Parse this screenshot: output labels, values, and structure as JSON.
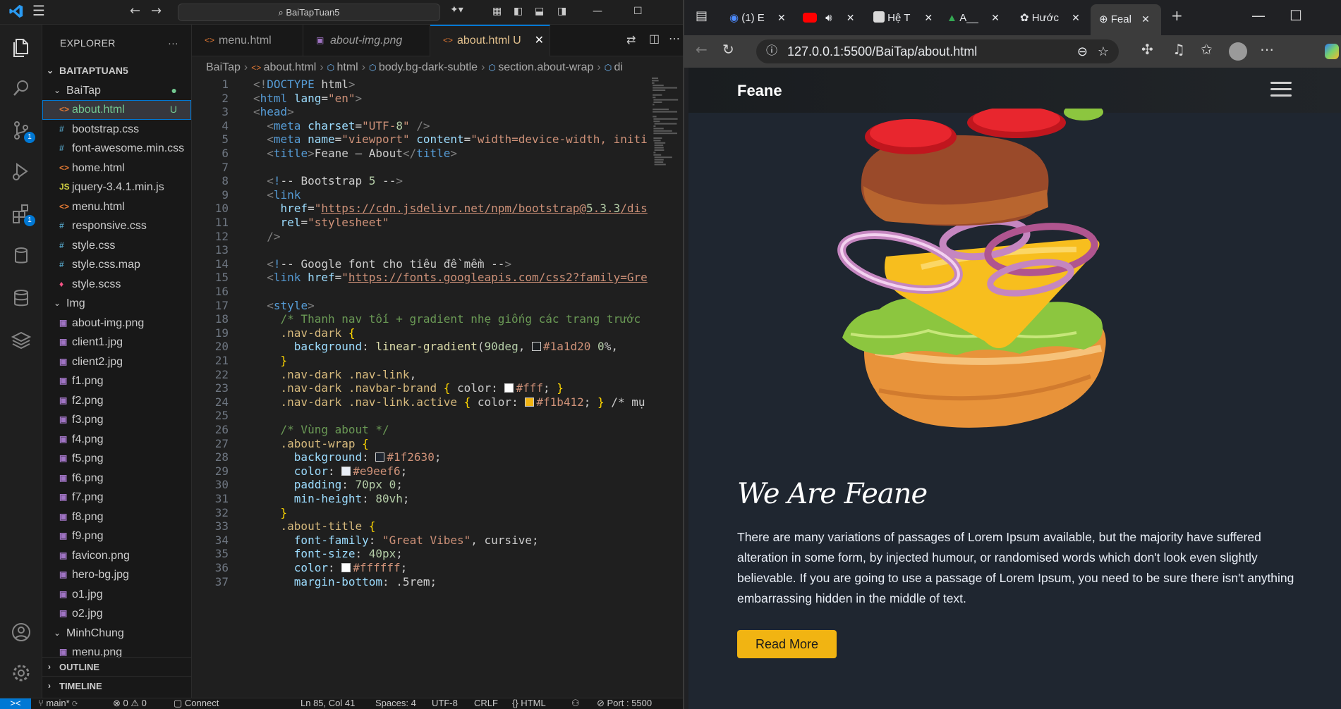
{
  "vscode": {
    "search_text": "BaiTapTuan5",
    "explorer_title": "EXPLORER",
    "project_name": "BAITAPTUAN5",
    "tree": [
      {
        "name": "BaiTap",
        "type": "folder",
        "status": "●"
      },
      {
        "name": "about.html",
        "type": "html",
        "status": "U",
        "selected": true
      },
      {
        "name": "bootstrap.css",
        "type": "css"
      },
      {
        "name": "font-awesome.min.css",
        "type": "css"
      },
      {
        "name": "home.html",
        "type": "html"
      },
      {
        "name": "jquery-3.4.1.min.js",
        "type": "js"
      },
      {
        "name": "menu.html",
        "type": "html"
      },
      {
        "name": "responsive.css",
        "type": "css"
      },
      {
        "name": "style.css",
        "type": "css"
      },
      {
        "name": "style.css.map",
        "type": "css"
      },
      {
        "name": "style.scss",
        "type": "scss"
      },
      {
        "name": "Img",
        "type": "folder"
      },
      {
        "name": "about-img.png",
        "type": "img"
      },
      {
        "name": "client1.jpg",
        "type": "img"
      },
      {
        "name": "client2.jpg",
        "type": "img"
      },
      {
        "name": "f1.png",
        "type": "img"
      },
      {
        "name": "f2.png",
        "type": "img"
      },
      {
        "name": "f3.png",
        "type": "img"
      },
      {
        "name": "f4.png",
        "type": "img"
      },
      {
        "name": "f5.png",
        "type": "img"
      },
      {
        "name": "f6.png",
        "type": "img"
      },
      {
        "name": "f7.png",
        "type": "img"
      },
      {
        "name": "f8.png",
        "type": "img"
      },
      {
        "name": "f9.png",
        "type": "img"
      },
      {
        "name": "favicon.png",
        "type": "img"
      },
      {
        "name": "hero-bg.jpg",
        "type": "img"
      },
      {
        "name": "o1.jpg",
        "type": "img"
      },
      {
        "name": "o2.jpg",
        "type": "img"
      },
      {
        "name": "MinhChung",
        "type": "folder"
      },
      {
        "name": "menu.png",
        "type": "img"
      }
    ],
    "outline_label": "OUTLINE",
    "timeline_label": "TIMELINE",
    "tabs": [
      {
        "label": "menu.html"
      },
      {
        "label": "about-img.png"
      },
      {
        "label": "about.html",
        "status": "U",
        "active": true
      }
    ],
    "breadcrumb": [
      "BaiTap",
      "about.html",
      "html",
      "body.bg-dark-subtle",
      "section.about-wrap",
      "di"
    ],
    "badges": {
      "source_control": "1",
      "extensions": "1"
    },
    "code_lines": [
      "<!DOCTYPE html>",
      "<html lang=\"en\">",
      "<head>",
      "  <meta charset=\"UTF-8\" />",
      "  <meta name=\"viewport\" content=\"width=device-width, initi",
      "  <title>Feane – About</title>",
      "",
      "  <!-- Bootstrap 5 -->",
      "  <link",
      "    href=\"https://cdn.jsdelivr.net/npm/bootstrap@5.3.3/dis",
      "    rel=\"stylesheet\"",
      "  />",
      "",
      "  <!-- Google font cho tiêu đề mềm -->",
      "  <link href=\"https://fonts.googleapis.com/css2?family=Gre",
      "",
      "  <style>",
      "    /* Thanh nav tối + gradient nhẹ giống các trang trước",
      "    .nav-dark {",
      "      background: linear-gradient(90deg, #1a1d20 0%, ",
      "    }",
      "    .nav-dark .nav-link,",
      "    .nav-dark .navbar-brand { color: #fff; }",
      "    .nav-dark .nav-link.active { color: #f1b412; } /* mụ",
      "",
      "    /* Vùng about */",
      "    .about-wrap {",
      "      background: #1f2630;",
      "      color: #e9eef6;",
      "      padding: 70px 0;",
      "      min-height: 80vh;",
      "    }",
      "    .about-title {",
      "      font-family: \"Great Vibes\", cursive;",
      "      font-size: 40px;",
      "      color: #ffffff;",
      "      margin-bottom: .5rem;"
    ],
    "status": {
      "branch": "main*",
      "problems": "⊗ 0 ⚠ 0",
      "connect": "Connect",
      "cursor": "Ln 85, Col 41",
      "spaces": "Spaces: 4",
      "encoding": "UTF-8",
      "eol": "CRLF",
      "language": "{} HTML",
      "port": "Port : 5500"
    }
  },
  "browser": {
    "tabs": [
      {
        "label": "(1) E"
      },
      {
        "label": ""
      },
      {
        "label": "Hệ T"
      },
      {
        "label": "A__"
      },
      {
        "label": "Hước"
      },
      {
        "label": "Feal",
        "active": true
      }
    ],
    "url": "127.0.0.1:5500/BaiTap/about.html",
    "page": {
      "brand": "Feane",
      "title": "We Are Feane",
      "paragraph": "There are many variations of passages of Lorem Ipsum available, but the majority have suffered alteration in some form, by injected humour, or randomised words which don't look even slightly believable. If you are going to use a passage of Lorem Ipsum, you need to be sure there isn't anything embarrassing hidden in the middle of text.",
      "button": "Read More",
      "colors": {
        "background": "#1f2630",
        "text": "#e9eef6",
        "accent": "#f1b412"
      }
    }
  }
}
